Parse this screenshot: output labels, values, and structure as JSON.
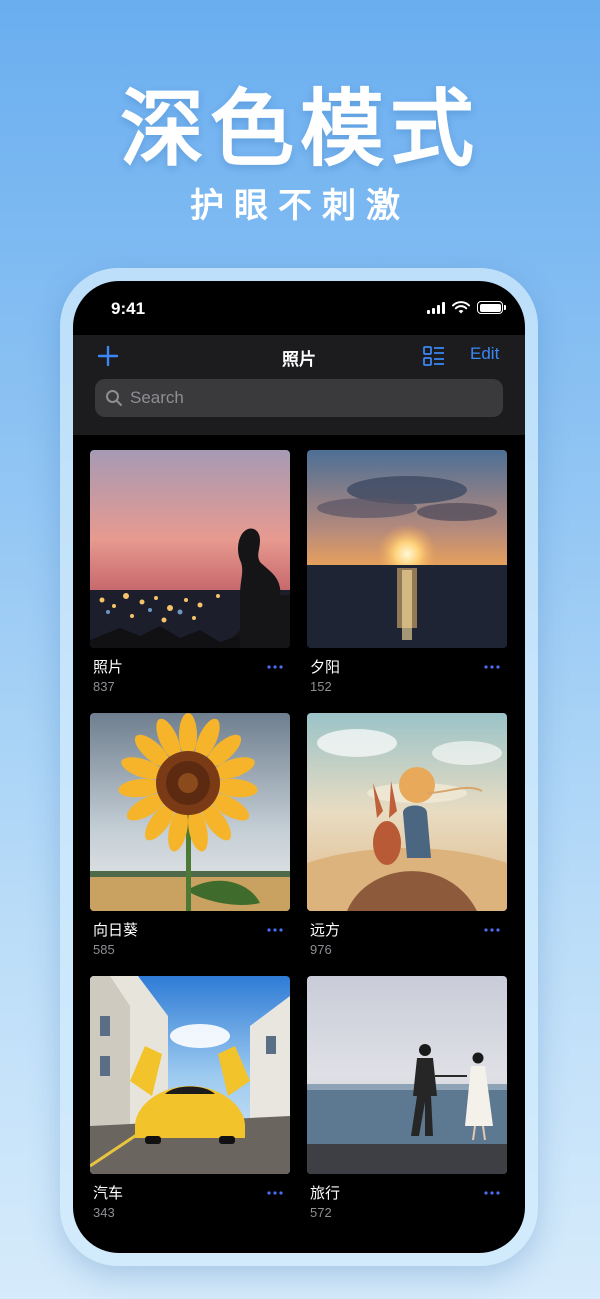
{
  "hero": {
    "title": "深色模式",
    "subtitle": "护眼不刺激"
  },
  "status_bar": {
    "time": "9:41"
  },
  "navbar": {
    "title": "照片",
    "edit_label": "Edit",
    "add_icon": "plus-icon",
    "grid_icon": "list-grid-icon"
  },
  "search": {
    "placeholder": "Search"
  },
  "albums": [
    {
      "name": "照片",
      "count": "837",
      "image": "silhouette-sunset-city"
    },
    {
      "name": "夕阳",
      "count": "152",
      "image": "sunset-over-sea"
    },
    {
      "name": "向日葵",
      "count": "585",
      "image": "sunflower"
    },
    {
      "name": "远方",
      "count": "976",
      "image": "little-prince-fox-desert"
    },
    {
      "name": "汽车",
      "count": "343",
      "image": "yellow-sports-car"
    },
    {
      "name": "旅行",
      "count": "572",
      "image": "couple-walking-by-sea"
    }
  ],
  "colors": {
    "accent": "#3a87f5",
    "navbar_bg": "#1c1c1e",
    "screen_bg": "#000000",
    "secondary_text": "#8e8e93"
  }
}
